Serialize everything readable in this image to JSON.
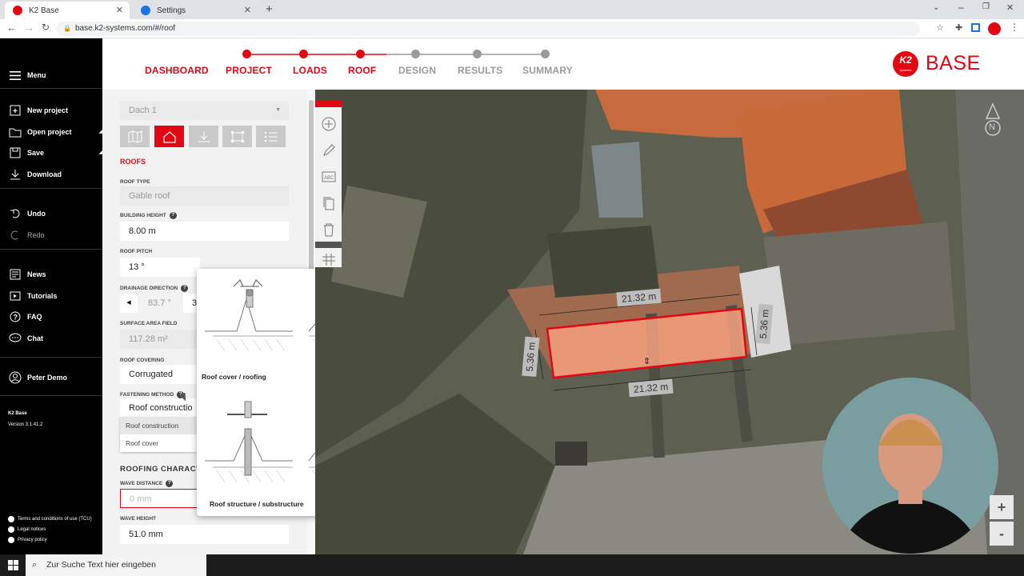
{
  "browser": {
    "tabs": [
      {
        "title": "K2 Base",
        "active": true
      },
      {
        "title": "Settings",
        "active": false
      }
    ],
    "url": "base.k2-systems.com/#/roof"
  },
  "menu": {
    "menu_label": "Menu",
    "items": [
      {
        "label": "New project",
        "icon": "new-project-icon"
      },
      {
        "label": "Open project",
        "icon": "folder-icon"
      },
      {
        "label": "Save",
        "icon": "save-icon"
      },
      {
        "label": "Download",
        "icon": "download-icon"
      },
      {
        "label": "Undo",
        "icon": "undo-icon"
      },
      {
        "label": "Redo",
        "icon": "redo-icon"
      },
      {
        "label": "News",
        "icon": "news-icon"
      },
      {
        "label": "Tutorials",
        "icon": "play-icon"
      },
      {
        "label": "FAQ",
        "icon": "help-icon"
      },
      {
        "label": "Chat",
        "icon": "chat-icon"
      }
    ],
    "user": "Peter Demo",
    "app_name": "K2 Base",
    "version": "Version 3.1.41.2",
    "legal": [
      "Terms and conditions of use (TCU)",
      "Legal notices",
      "Privacy policy"
    ]
  },
  "stepper": {
    "steps": [
      {
        "label": "DASHBOARD",
        "done": true,
        "dot": false
      },
      {
        "label": "PROJECT",
        "done": true,
        "dot": true
      },
      {
        "label": "LOADS",
        "done": true,
        "dot": true
      },
      {
        "label": "ROOF",
        "done": true,
        "dot": true
      },
      {
        "label": "DESIGN",
        "done": false,
        "dot": true
      },
      {
        "label": "RESULTS",
        "done": false,
        "dot": true
      },
      {
        "label": "SUMMARY",
        "done": false,
        "dot": true
      }
    ],
    "active_color": "#e30613",
    "inactive_color": "#9a9a9a"
  },
  "brand": {
    "logo_text": "K2",
    "logo_sub": "systems",
    "name": "BASE",
    "color": "#e30613"
  },
  "panel": {
    "roof_select": "Dach 1",
    "section_title": "ROOFS",
    "roof_type_label": "ROOF TYPE",
    "roof_type_value": "Gable roof",
    "building_height_label": "BUILDING HEIGHT",
    "building_height_value": "8.00 m",
    "roof_pitch_label": "ROOF PITCH",
    "roof_pitch_value": "13 °",
    "drainage_label": "DRAINAGE DIRECTION",
    "drainage_value": "83.7 °",
    "drainage_value2": "3",
    "surface_label": "SURFACE AREA FIELD",
    "surface_value": "117.28 m²",
    "covering_label": "ROOF COVERING",
    "covering_value": "Corrugated",
    "fastening_label": "FASTENING METHOD",
    "fastening_value": "Roof constructio",
    "fastening_options": [
      "Roof construction",
      "Roof cover"
    ],
    "roofing_char_title": "ROOFING CHARACT",
    "wave_distance_label": "WAVE DISTANCE",
    "wave_distance_placeholder": "0 mm",
    "wave_height_label": "WAVE HEIGHT",
    "wave_height_value": "51.0 mm"
  },
  "tooltip": {
    "caption_top": "Roof cover / roofing",
    "caption_bottom": "Roof structure / substructure"
  },
  "map": {
    "dims": {
      "top": "21.32 m",
      "bottom": "21.32 m",
      "left": "5.36 m",
      "right": "5.36 m"
    },
    "compass": "N",
    "zoom_in": "+",
    "zoom_out": "-"
  },
  "taskbar": {
    "search_placeholder": "Zur Suche Text hier eingeben"
  }
}
